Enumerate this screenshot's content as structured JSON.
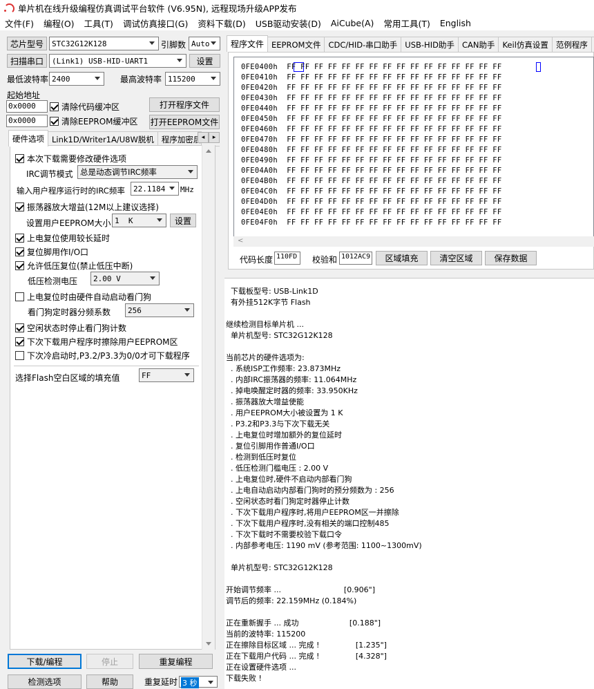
{
  "window": {
    "title": "单片机在线升级编程仿真调试平台软件 (V6.95N), 远程现场升级APP发布"
  },
  "menu": [
    "文件(F)",
    "编程(O)",
    "工具(T)",
    "调试仿真接口(G)",
    "资料下载(D)",
    "USB驱动安装(D)",
    "AiCube(A)",
    "常用工具(T)",
    "English"
  ],
  "left": {
    "chip_button": "芯片型号",
    "chip_value": "STC32G12K128",
    "pins_label": "引脚数",
    "pins_value": "Auto",
    "scan_button": "扫描串口",
    "port_value": "(Link1) USB-HID-UART1",
    "settings_button": "设置",
    "min_baud_label": "最低波特率",
    "min_baud_value": "2400",
    "max_baud_label": "最高波特率",
    "max_baud_value": "115200",
    "start_addr_label": "起始地址",
    "addr1": "0x0000",
    "clear_code_buf": "清除代码缓冲区",
    "open_program": "打开程序文件",
    "addr2": "0x0000",
    "clear_eeprom_buf": "清除EEPROM缓冲区",
    "open_eeprom": "打开EEPROM文件",
    "tabs": [
      "硬件选项",
      "Link1D/Writer1A/U8W脱机",
      "程序加密后"
    ],
    "hw": {
      "opt_modify": "本次下载需要修改硬件选项",
      "irc_mode_label": "IRC调节模式",
      "irc_mode_value": "总是动态调节IRC频率",
      "irc_freq_label": "输入用户程序运行时的IRC频率",
      "irc_freq_value": "22.1184",
      "irc_freq_unit": "MHz",
      "osc_gain": "振荡器放大增益(12M以上建议选择)",
      "eeprom_size_label": "设置用户EEPROM大小",
      "eeprom_size_value": "1  K",
      "eeprom_set_button": "设置",
      "long_reset": "上电复位使用较长延时",
      "reset_io": "复位脚用作I/O口",
      "lvd_reset": "允许低压复位(禁止低压中断)",
      "lvd_label": "低压检测电压",
      "lvd_value": "2.00 V",
      "wdt_hw": "上电复位时由硬件自动启动看门狗",
      "wdt_div_label": "看门狗定时器分频系数",
      "wdt_div_value": "256",
      "wdt_idle": "空闲状态时停止看门狗计数",
      "erase_eeprom": "下次下载用户程序时擦除用户EEPROM区",
      "p32p33": "下次冷启动时,P3.2/P3.3为0/0才可下载程序",
      "fill_label": "选择Flash空白区域的填充值",
      "fill_value": "FF"
    },
    "btn_download": "下载/编程",
    "btn_stop": "停止",
    "btn_reprogram": "重复编程",
    "btn_check": "检测选项",
    "btn_help": "帮助",
    "repeat_delay_label": "重复延时",
    "repeat_delay_value": "3 秒"
  },
  "right": {
    "tabs": [
      "程序文件",
      "EEPROM文件",
      "CDC/HID-串口助手",
      "USB-HID助手",
      "CAN助手",
      "Keil仿真设置",
      "范例程序",
      "I/"
    ],
    "hex_rows": [
      {
        "addr": "0FE0400h",
        "data": "FF FF FF FF FF FF FF FF FF FF FF FF FF FF FF FF"
      },
      {
        "addr": "0FE0410h",
        "data": "FF FF FF FF FF FF FF FF FF FF FF FF FF FF FF FF"
      },
      {
        "addr": "0FE0420h",
        "data": "FF FF FF FF FF FF FF FF FF FF FF FF FF FF FF FF"
      },
      {
        "addr": "0FE0430h",
        "data": "FF FF FF FF FF FF FF FF FF FF FF FF FF FF FF FF"
      },
      {
        "addr": "0FE0440h",
        "data": "FF FF FF FF FF FF FF FF FF FF FF FF FF FF FF FF"
      },
      {
        "addr": "0FE0450h",
        "data": "FF FF FF FF FF FF FF FF FF FF FF FF FF FF FF FF"
      },
      {
        "addr": "0FE0460h",
        "data": "FF FF FF FF FF FF FF FF FF FF FF FF FF FF FF FF"
      },
      {
        "addr": "0FE0470h",
        "data": "FF FF FF FF FF FF FF FF FF FF FF FF FF FF FF FF"
      },
      {
        "addr": "0FE0480h",
        "data": "FF FF FF FF FF FF FF FF FF FF FF FF FF FF FF FF"
      },
      {
        "addr": "0FE0490h",
        "data": "FF FF FF FF FF FF FF FF FF FF FF FF FF FF FF FF"
      },
      {
        "addr": "0FE04A0h",
        "data": "FF FF FF FF FF FF FF FF FF FF FF FF FF FF FF FF"
      },
      {
        "addr": "0FE04B0h",
        "data": "FF FF FF FF FF FF FF FF FF FF FF FF FF FF FF FF"
      },
      {
        "addr": "0FE04C0h",
        "data": "FF FF FF FF FF FF FF FF FF FF FF FF FF FF FF FF"
      },
      {
        "addr": "0FE04D0h",
        "data": "FF FF FF FF FF FF FF FF FF FF FF FF FF FF FF FF"
      },
      {
        "addr": "0FE04E0h",
        "data": "FF FF FF FF FF FF FF FF FF FF FF FF FF FF FF FF"
      },
      {
        "addr": "0FE04F0h",
        "data": "FF FF FF FF FF FF FF FF FF FF FF FF FF FF FF FF"
      }
    ],
    "code_len_label": "代码长度",
    "code_len_value": "110FD",
    "checksum_label": "校验和",
    "checksum_value": "1012AC9",
    "btn_fill": "区域填充",
    "btn_clear": "清空区域",
    "btn_save": "保存数据",
    "log": [
      "  下载板型号: USB-Link1D",
      "  有外挂512K字节 Flash",
      "",
      "继续检测目标单片机 ...",
      "  单片机型号: STC32G12K128",
      "",
      "当前芯片的硬件选项为:",
      "  . 系统ISP工作频率: 23.873MHz",
      "  . 内部IRC振荡器的频率: 11.064MHz",
      "  . 掉电唤醒定时器的频率: 33.950KHz",
      "  . 振荡器放大增益使能",
      "  . 用户EEPROM大小被设置为 1 K",
      "  . P3.2和P3.3与下次下载无关",
      "  . 上电复位时增加额外的复位延时",
      "  . 复位引脚用作普通I/O口",
      "  . 检测到低压时复位",
      "  . 低压检测门槛电压 : 2.00 V",
      "  . 上电复位时,硬件不启动内部看门狗",
      "  . 上电自动启动内部看门狗时的预分频数为 : 256",
      "  . 空闲状态时看门狗定时器停止计数",
      "  . 下次下载用户程序时,将用户EEPROM区一并擦除",
      "  . 下次下载用户程序时,没有相关的端口控制485",
      "  . 下次下载时不需要校验下载口令",
      "  . 内部参考电压: 1190 mV (参考范围: 1100~1300mV)",
      "",
      "  单片机型号: STC32G12K128",
      "",
      "开始调节频率 ...                          [0.906\"]",
      "调节后的频率: 22.159MHz (0.184%)",
      "",
      "正在重新握手 ... 成功                     [0.188\"]",
      "当前的波特率: 115200",
      "正在擦除目标区域 ... 完成 !               [1.235\"]",
      "正在下载用户代码 ... 完成 !               [4.328\"]",
      "正在设置硬件选项 ...",
      "下载失败 !"
    ]
  }
}
